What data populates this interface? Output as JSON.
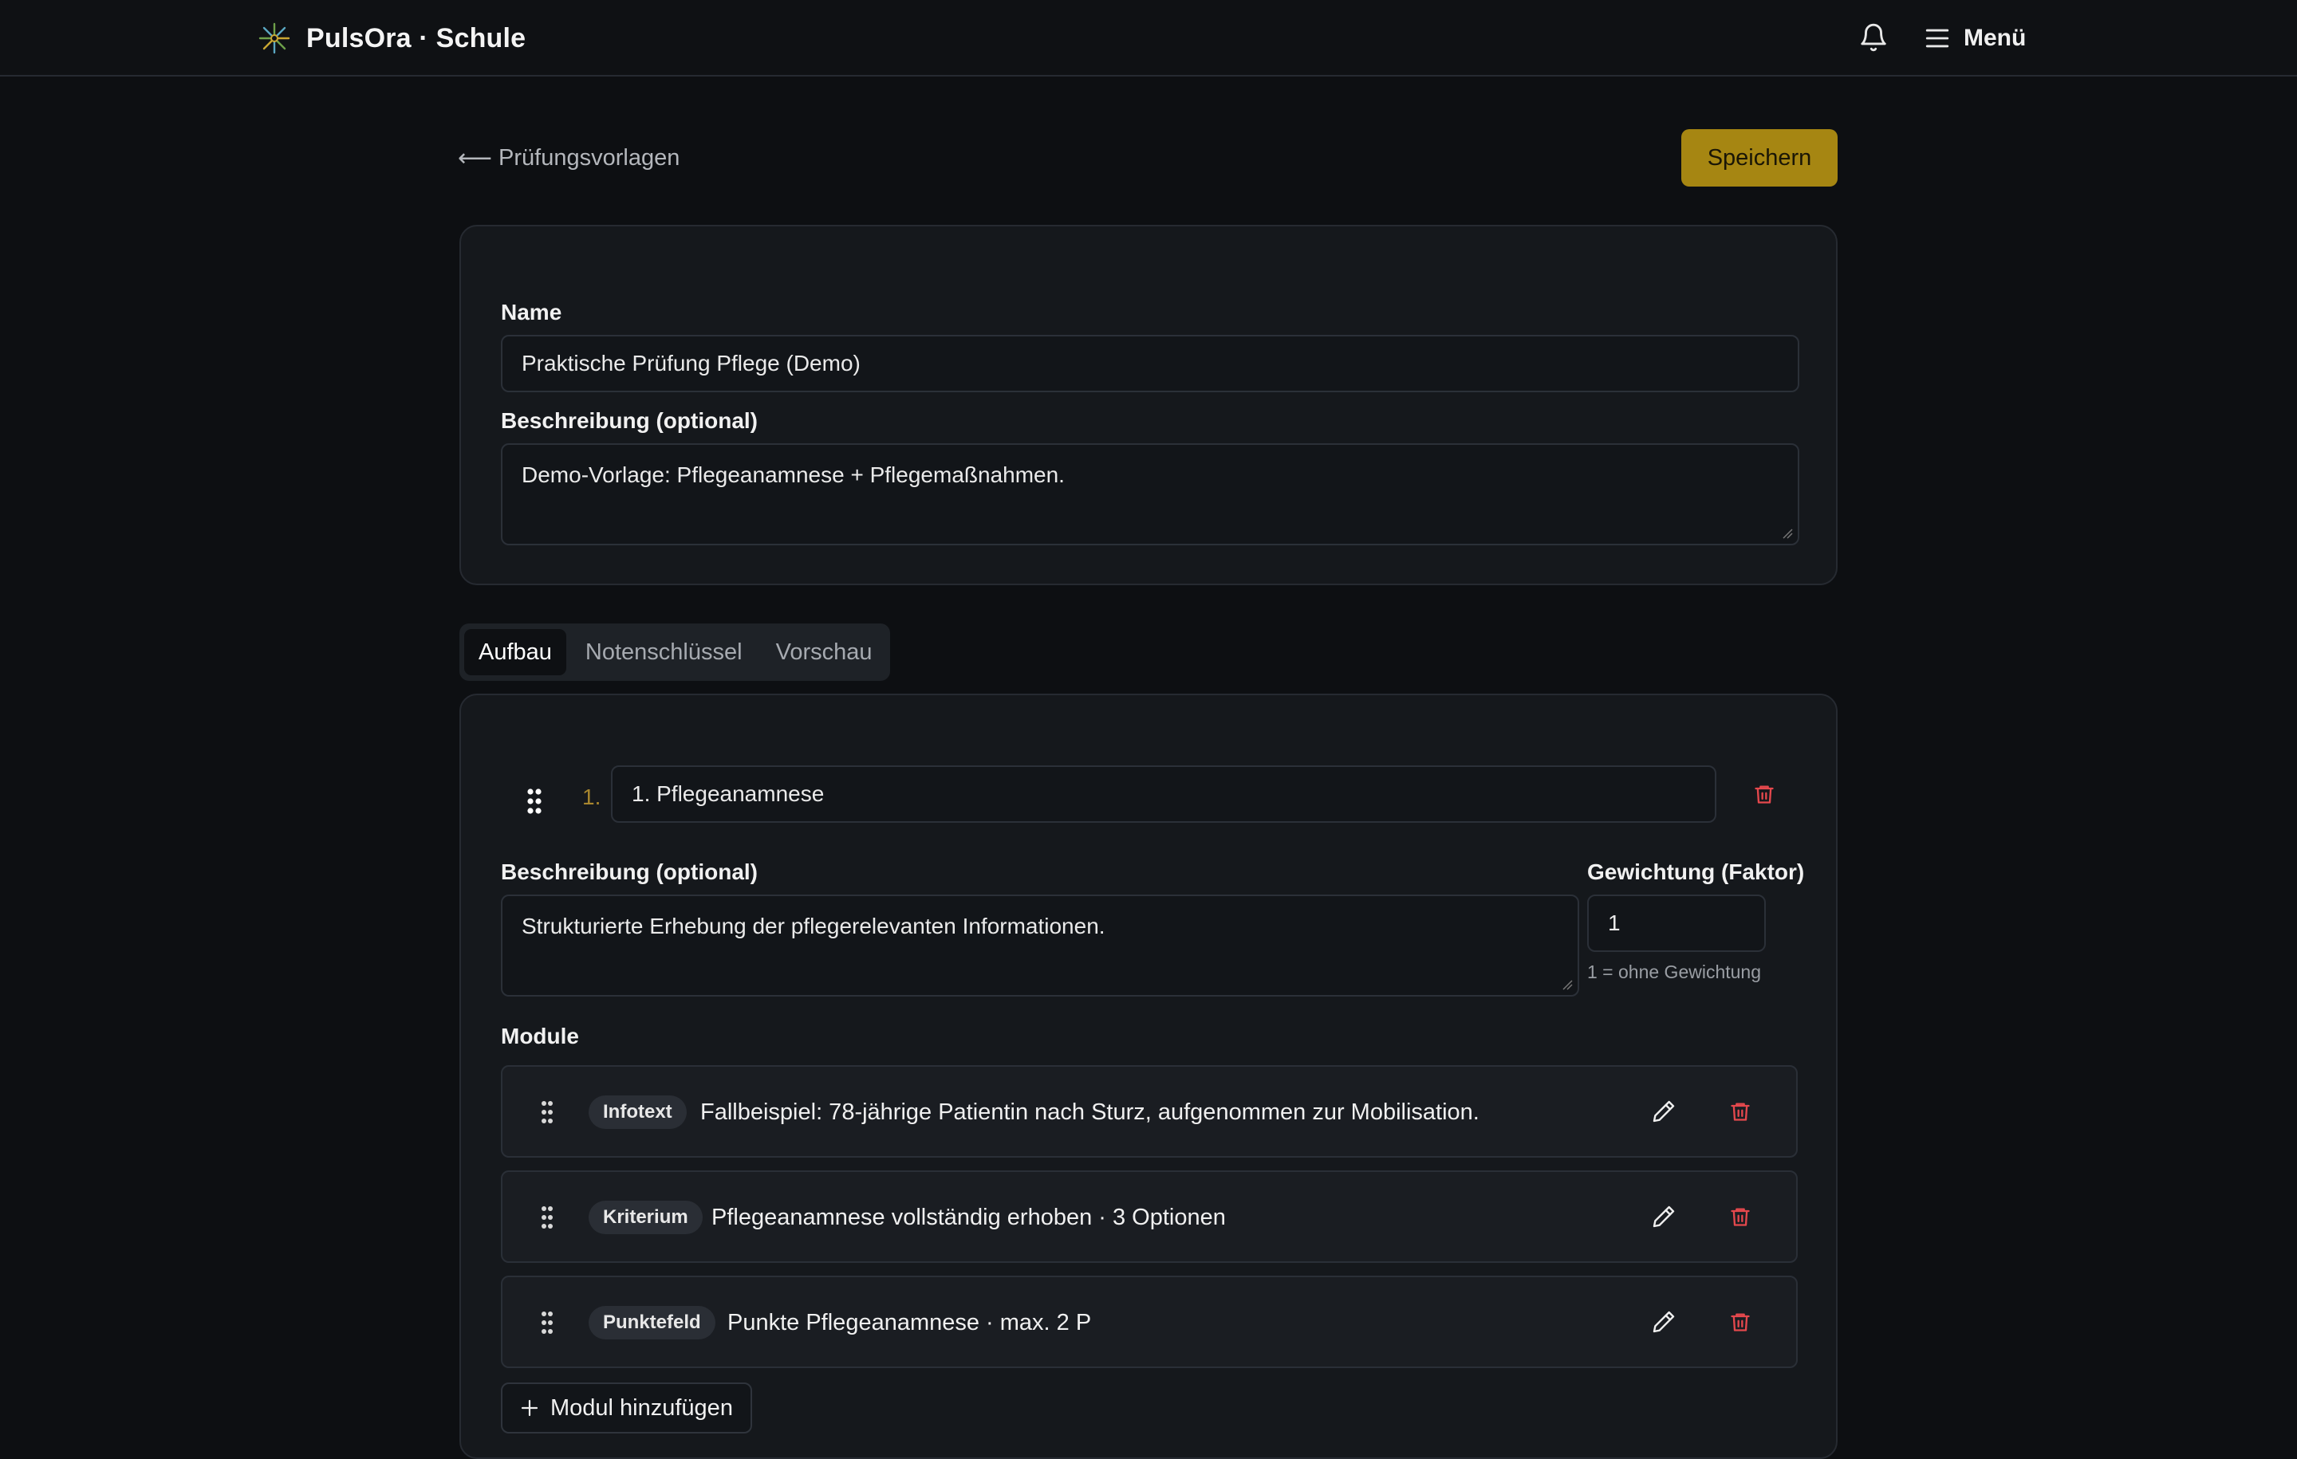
{
  "nav": {
    "brand": "PulsOra · Schule",
    "menu_label": "Menü"
  },
  "header": {
    "back_label": "Prüfungsvorlagen",
    "save_label": "Speichern"
  },
  "template": {
    "name_label": "Name",
    "name_value": "Praktische Prüfung Pflege (Demo)",
    "description_label": "Beschreibung (optional)",
    "description_value": "Demo-Vorlage: Pflegeanamnese + Pflegemaßnahmen."
  },
  "tabs": [
    {
      "label": "Aufbau",
      "active": true
    },
    {
      "label": "Notenschlüssel",
      "active": false
    },
    {
      "label": "Vorschau",
      "active": false
    }
  ],
  "section": {
    "number": "1.",
    "title": "1. Pflegeanamnese",
    "description_label": "Beschreibung (optional)",
    "description_value": "Strukturierte Erhebung der pflegerelevanten Informationen.",
    "weight_label": "Gewichtung (Faktor)",
    "weight_value": "1",
    "weight_hint": "1 = ohne Gewichtung",
    "modules_label": "Module",
    "modules": [
      {
        "type": "Infotext",
        "text": "Fallbeispiel: 78-jährige Patientin nach Sturz, aufgenommen zur Mobilisation."
      },
      {
        "type": "Kriterium",
        "text": "Pflegeanamnese vollständig erhoben · 3 Optionen"
      },
      {
        "type": "Punktefeld",
        "text": "Punkte Pflegeanamnese · max. 2 P"
      }
    ],
    "add_module_label": "Modul hinzufügen"
  },
  "colors": {
    "accent": "#a68612",
    "danger": "#e5484d",
    "background": "#0d0f12",
    "card": "#15181c"
  },
  "icons": [
    "brand-logo-icon",
    "bell-icon",
    "hamburger-menu-icon",
    "arrow-left-icon",
    "drag-handle-icon",
    "trash-icon",
    "pencil-icon",
    "plus-icon"
  ]
}
